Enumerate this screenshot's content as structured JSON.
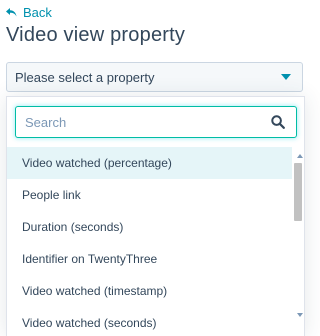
{
  "back_label": "Back",
  "page_title": "Video view property",
  "select": {
    "placeholder": "Please select a property"
  },
  "search": {
    "placeholder": "Search"
  },
  "options": [
    {
      "label": "Video watched (percentage)"
    },
    {
      "label": "People link"
    },
    {
      "label": "Duration (seconds)"
    },
    {
      "label": "Identifier on TwentyThree"
    },
    {
      "label": "Video watched (timestamp)"
    },
    {
      "label": "Video watched (seconds)"
    }
  ],
  "colors": {
    "accent": "#0091ae",
    "focus_border": "#00bda5",
    "hover_row": "#e5f5f8",
    "text": "#33475b"
  }
}
